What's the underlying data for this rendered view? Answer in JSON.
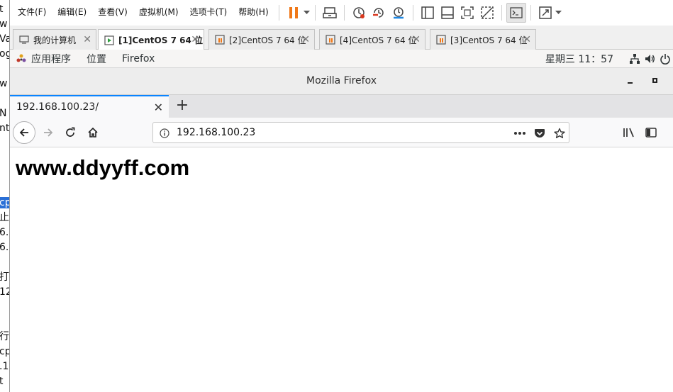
{
  "background_window": {
    "fragments": [
      "t",
      "w",
      "Va",
      "og",
      "w",
      "N",
      "nt",
      "cp",
      "止",
      "6.",
      "6.",
      "打",
      "12",
      "行",
      "cp",
      ".1",
      "t"
    ]
  },
  "vm_menu": {
    "items": [
      "文件(F)",
      "编辑(E)",
      "查看(V)",
      "虚拟机(M)",
      "选项卡(T)",
      "帮助(H)"
    ],
    "icons": [
      "pause-icon",
      "send-keys-icon",
      "snapshot-icon",
      "revert-snapshot-icon",
      "snapshot-manager-icon",
      "sidebar-view-icon",
      "console-view-icon",
      "fullscreen-icon",
      "unity-icon",
      "terminal-icon",
      "stretch-icon"
    ]
  },
  "vm_tabs": [
    {
      "label": "我的计算机",
      "active": false
    },
    {
      "label": "[1]CentOS 7 64 位",
      "active": true
    },
    {
      "label": "[2]CentOS 7 64 位",
      "active": false
    },
    {
      "label": "[4]CentOS 7 64 位",
      "active": false
    },
    {
      "label": "[3]CentOS 7 64 位",
      "active": false
    }
  ],
  "gnome": {
    "applications": "应用程序",
    "places": "位置",
    "active_app": "Firefox",
    "clock": "星期三 11：57"
  },
  "firefox": {
    "window_title": "Mozilla Firefox",
    "tab_title": "192.168.100.23/",
    "url": "192.168.100.23"
  },
  "page": {
    "heading": "www.ddyyff.com"
  },
  "colors": {
    "accent_blue": "#0a84ff",
    "pause_orange": "#f07818",
    "snapshot_red": "#d9381e",
    "selection_blue": "#2a6fd6"
  }
}
